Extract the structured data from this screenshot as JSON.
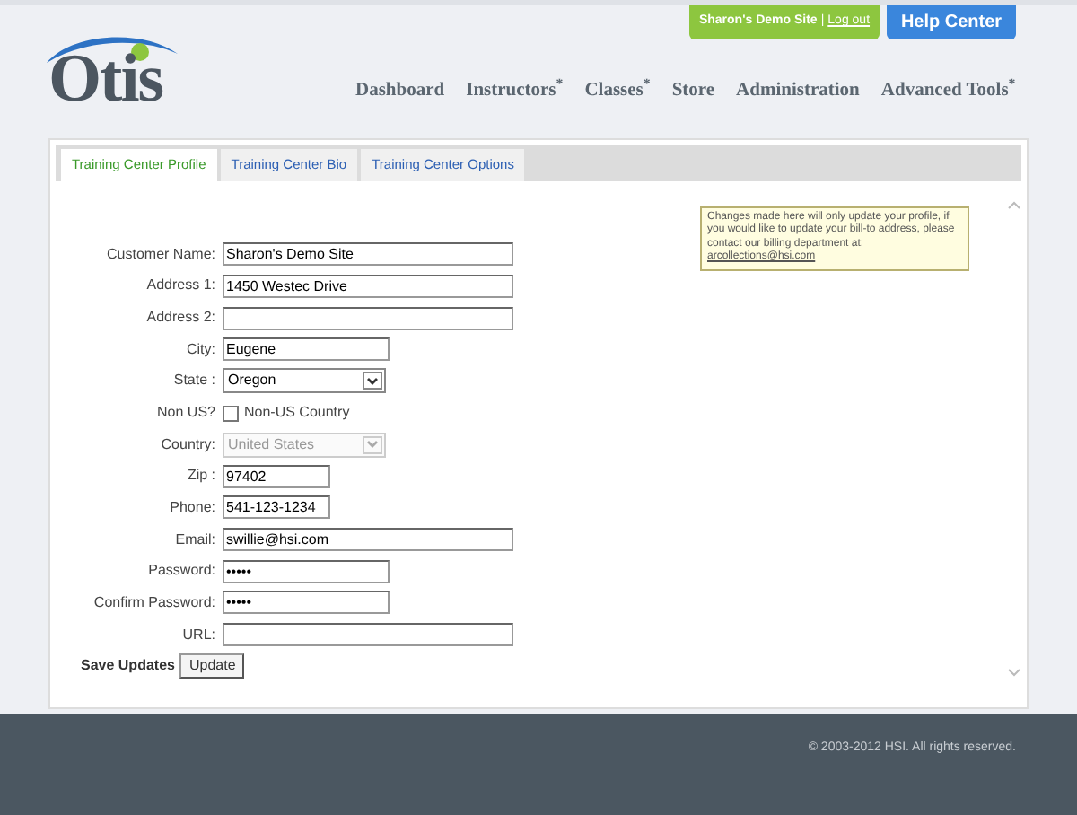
{
  "top_bar": {
    "site_name": "Sharon's Demo Site",
    "separator": "|",
    "logout_link": "Log out",
    "help_button": "Help Center"
  },
  "logo": {
    "text": "Otis"
  },
  "nav": [
    {
      "label": "Dashboard"
    },
    {
      "label": "Instructors$^{*}$"
    },
    {
      "label": "Classes$^{*}$"
    },
    {
      "label": "Store"
    },
    {
      "label": "Administration"
    },
    {
      "label": "Advanced Tools$^{*}$"
    }
  ],
  "tabs": [
    {
      "label": "Training Center Profile",
      "selected": true
    },
    {
      "label": "Training Center Bio",
      "selected": false
    },
    {
      "label": "Training Center Options",
      "selected": false
    }
  ],
  "notice": {
    "text": "Changes made here will only update your profile, if you would like to update your bill-to address, please contact our billing department at:",
    "link": "arcollections@hsi.com"
  },
  "form": [
    {
      "kind": "text",
      "label": "Customer Name:",
      "value": "Sharon's Demo Site"
    },
    {
      "kind": "text",
      "label": "Address 1:",
      "value": "1450 Westec Drive"
    },
    {
      "kind": "text",
      "label": "Address 2:"
    },
    {
      "kind": "text",
      "label": "City:",
      "value": "Eugene"
    },
    {
      "kind": "select",
      "label": "State :",
      "value": "Oregon",
      "disabled": false
    },
    {
      "kind": "checkbox",
      "label": "Non US?",
      "option": "Non-US Country",
      "checked": false
    },
    {
      "kind": "select",
      "label": "Country:",
      "value": "United States",
      "disabled": true
    },
    {
      "kind": "text",
      "label": "Zip :",
      "value": "97402"
    },
    {
      "kind": "text",
      "label": "Phone:",
      "value": "541-123-1234"
    },
    {
      "kind": "text",
      "label": "Email:",
      "value": "swillie@hsi.com"
    },
    {
      "kind": "password",
      "label": "Password:",
      "value": "•••••"
    },
    {
      "kind": "password",
      "label": "Confirm Password:",
      "value": "•••••"
    },
    {
      "kind": "text",
      "label": "URL:"
    }
  ],
  "save": {
    "label": "Save Updates",
    "button": "Update"
  },
  "footer": {
    "copyright": "© 2003-2012 HSI. All rights reserved."
  }
}
